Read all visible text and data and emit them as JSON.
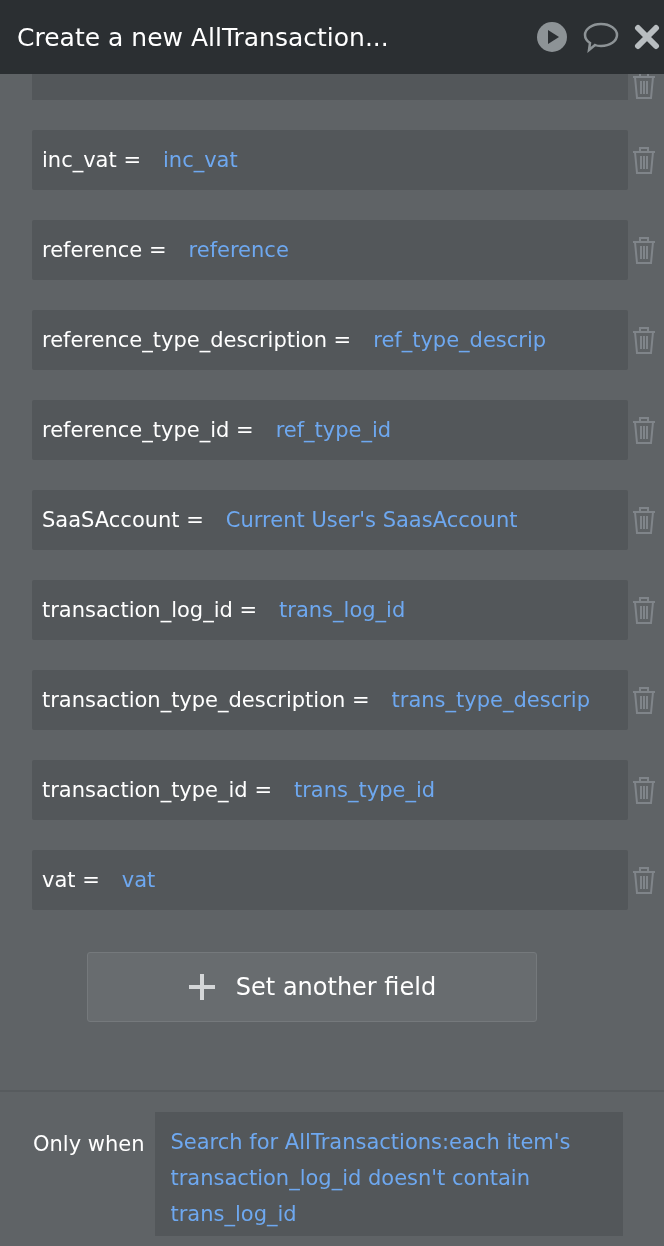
{
  "header": {
    "title": "Create a new AllTransaction..."
  },
  "fields": [
    {
      "key": "inc_vat =",
      "value": "inc_vat"
    },
    {
      "key": "reference =",
      "value": "reference"
    },
    {
      "key": "reference_type_description =",
      "value": "ref_type_descrip"
    },
    {
      "key": "reference_type_id =",
      "value": "ref_type_id"
    },
    {
      "key": "SaaSAccount =",
      "value": "Current User's SaasAccount"
    },
    {
      "key": "transaction_log_id =",
      "value": "trans_log_id"
    },
    {
      "key": "transaction_type_description =",
      "value": "trans_type_descrip"
    },
    {
      "key": "transaction_type_id =",
      "value": "trans_type_id"
    },
    {
      "key": "vat =",
      "value": "vat"
    }
  ],
  "add_button": {
    "label": "Set another field"
  },
  "condition": {
    "label": "Only when",
    "expression": "Search for AllTransactions:each item's transaction_log_id doesn't contain trans_log_id"
  }
}
